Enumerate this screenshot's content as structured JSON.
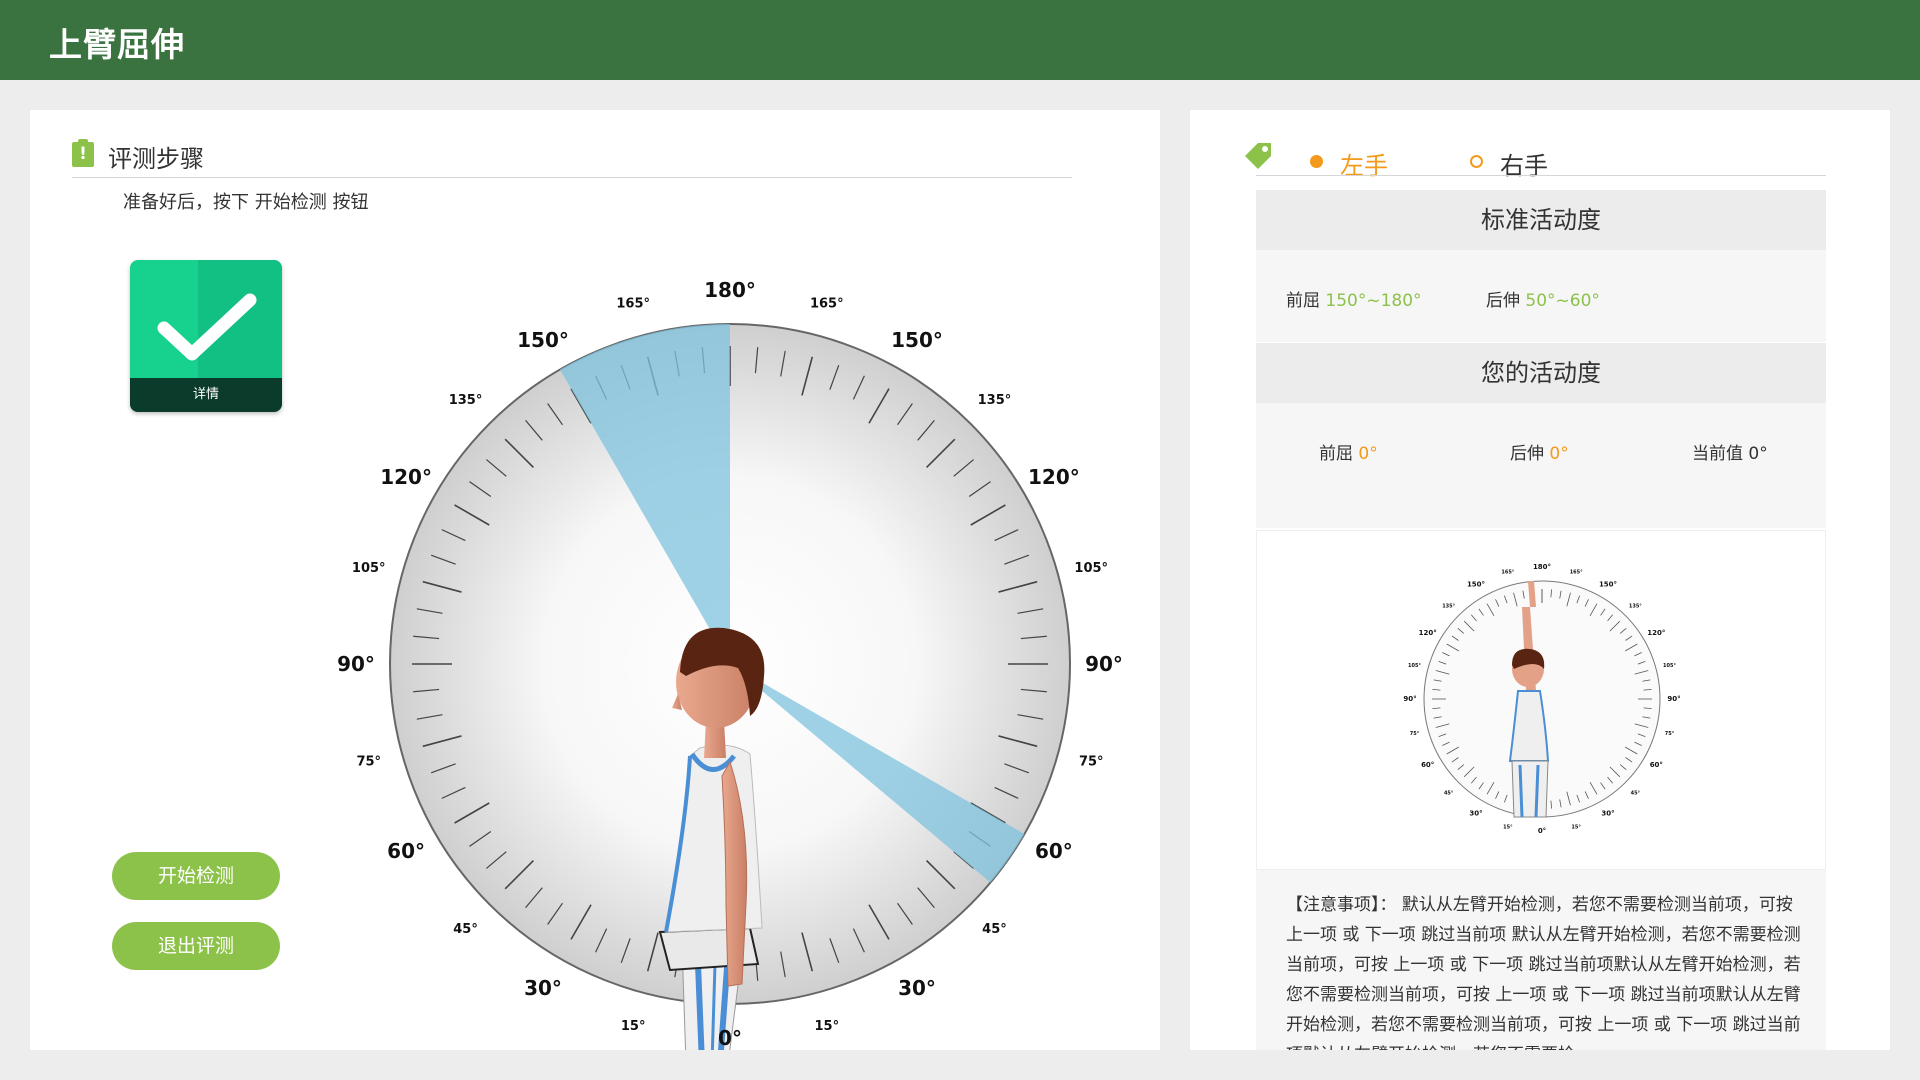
{
  "header": {
    "title": "上臂屈伸"
  },
  "steps": {
    "title": "评测步骤",
    "instruction": "准备好后，按下 开始检测 按钮",
    "detail_label": "详情",
    "start_button": "开始检测",
    "exit_button": "退出评测"
  },
  "dial": {
    "labels_major": [
      "180°",
      "150°",
      "150°",
      "120°",
      "120°",
      "90°",
      "90°",
      "60°",
      "60°",
      "30°",
      "30°",
      "0°"
    ],
    "labels_minor": [
      "165°",
      "165°",
      "135°",
      "135°",
      "105°",
      "105°",
      "75°",
      "75°",
      "45°",
      "45°",
      "15°",
      "15°"
    ]
  },
  "hands": {
    "left_label": "左手",
    "right_label": "右手",
    "selected": "左手"
  },
  "standard": {
    "title": "标准活动度",
    "flexion_label": "前屈",
    "flexion_value": "150°~180°",
    "extension_label": "后伸",
    "extension_value": "50°~60°"
  },
  "yours": {
    "title": "您的活动度",
    "flexion_label": "前屈",
    "flexion_value": "0°",
    "extension_label": "后伸",
    "extension_value": "0°",
    "current_label": "当前值",
    "current_value": "0°"
  },
  "notes": {
    "text": "【注意事项】： 默认从左臂开始检测，若您不需要检测当前项，可按 上一项 或 下一项 跳过当前项 默认从左臂开始检测，若您不需要检测当前项，可按 上一项 或 下一项 跳过当前项默认从左臂开始检测，若您不需要检测当前项，可按 上一项 或 下一项 跳过当前项默认从左臂开始检测，若您不需要检测当前项，可按 上一项 或 下一项 跳过当前项默认从左臂开始检测，若您不需要检"
  },
  "colors": {
    "header_bg": "#3b7340",
    "accent_green": "#8dc24a",
    "accent_orange": "#f39a1d",
    "card_green": "#17d28e",
    "sector_blue": "#7fc3de"
  },
  "icons": [
    "clipboard-alert-icon",
    "checkmark-icon",
    "tag-icon"
  ]
}
